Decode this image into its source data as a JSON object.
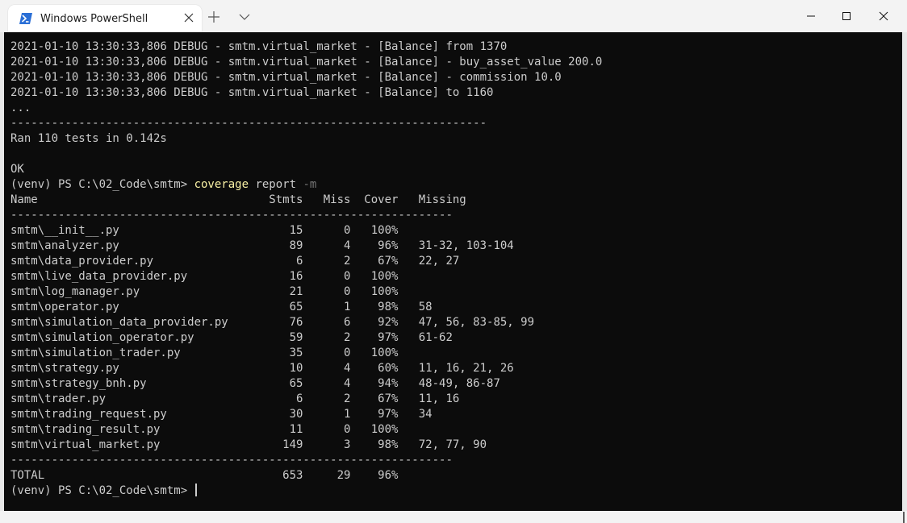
{
  "window": {
    "tab_title": "Windows PowerShell",
    "tab_icon": "powershell-icon",
    "controls": [
      "minimize-icon",
      "maximize-icon",
      "close-icon"
    ]
  },
  "colors": {
    "terminal_bg": "#0c0c0c",
    "terminal_text": "#cccccc",
    "command_text": "#f9f1a5",
    "argument_text": "#767676",
    "powershell_icon": "#2b6fd6"
  },
  "terminal": {
    "log_lines": [
      "2021-01-10 13:30:33,806 DEBUG - smtm.virtual_market - [Balance] from 1370",
      "2021-01-10 13:30:33,806 DEBUG - smtm.virtual_market - [Balance] - buy_asset_value 200.0",
      "2021-01-10 13:30:33,806 DEBUG - smtm.virtual_market - [Balance] - commission 10.0",
      "2021-01-10 13:30:33,806 DEBUG - smtm.virtual_market - [Balance] to 1160",
      "..."
    ],
    "separator_long": "----------------------------------------------------------------------",
    "ran_line": "Ran 110 tests in 0.142s",
    "ok_line": "OK",
    "prompt": "(venv) PS C:\\02_Code\\smtm> ",
    "command": "coverage",
    "command_args": " report ",
    "command_flag": "-m",
    "header_line": "Name                                  Stmts   Miss  Cover   Missing",
    "separator_short": "-----------------------------------------------------------------",
    "rows_text": "smtm\\__init__.py                         15      0   100%\nsmtm\\analyzer.py                         89      4    96%   31-32, 103-104\nsmtm\\data_provider.py                     6      2    67%   22, 27\nsmtm\\live_data_provider.py               16      0   100%\nsmtm\\log_manager.py                      21      0   100%\nsmtm\\operator.py                         65      1    98%   58\nsmtm\\simulation_data_provider.py         76      6    92%   47, 56, 83-85, 99\nsmtm\\simulation_operator.py              59      2    97%   61-62\nsmtm\\simulation_trader.py                35      0   100%\nsmtm\\strategy.py                         10      4    60%   11, 16, 21, 26\nsmtm\\strategy_bnh.py                     65      4    94%   48-49, 86-87\nsmtm\\trader.py                            6      2    67%   11, 16\nsmtm\\trading_request.py                  30      1    97%   34\nsmtm\\trading_result.py                   11      0   100%\nsmtm\\virtual_market.py                  149      3    98%   72, 77, 90",
    "total_line": "TOTAL                                   653     29    96%",
    "final_prompt": "(venv) PS C:\\02_Code\\smtm> "
  }
}
